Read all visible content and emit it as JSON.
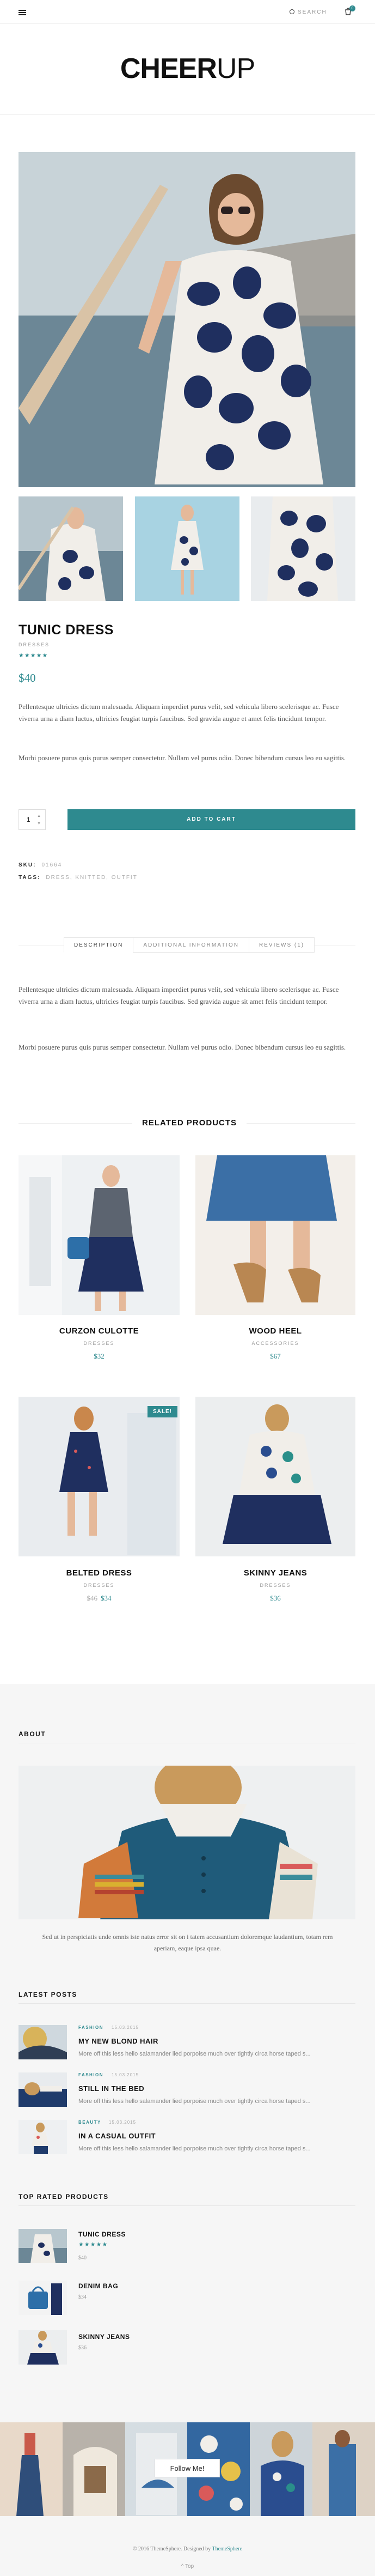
{
  "header": {
    "search_label": "SEARCH",
    "cart_count": "0",
    "logo_bold": "CHEER",
    "logo_thin": "UP"
  },
  "product": {
    "title": "TUNIC DRESS",
    "category": "DRESSES",
    "rating_stars": "★★★★★",
    "price": "$40",
    "desc1": "Pellentesque ultricies dictum malesuada. Aliquam imperdiet purus velit, sed vehicula libero scelerisque ac. Fusce viverra urna a diam luctus, ultricies feugiat turpis faucibus. Sed gravida augue et amet felis tincidunt tempor.",
    "desc2": "Morbi posuere purus quis purus semper consectetur. Nullam vel purus odio. Donec bibendum cursus leo eu sagittis.",
    "qty": "1",
    "add_to_cart": "ADD TO CART",
    "sku_label": "SKU:",
    "sku_value": "01664",
    "tags_label": "TAGS:",
    "tags_value": "DRESS, KNITTED, OUTFIT"
  },
  "tabs": [
    "DESCRIPTION",
    "ADDITIONAL INFORMATION",
    "REVIEWS (1)"
  ],
  "description": {
    "p1": "Pellentesque ultricies dictum malesuada. Aliquam imperdiet purus velit, sed vehicula libero scelerisque ac. Fusce viverra urna a diam luctus, ultricies feugiat turpis faucibus. Sed gravida augue sit amet felis tincidunt tempor.",
    "p2": "Morbi posuere purus quis purus semper consectetur. Nullam vel purus odio. Donec bibendum cursus leo eu sagittis."
  },
  "related": {
    "title": "RELATED PRODUCTS",
    "items": [
      {
        "name": "CURZON CULOTTE",
        "cat": "DRESSES",
        "price": "$32",
        "old": ""
      },
      {
        "name": "WOOD HEEL",
        "cat": "ACCESSORIES",
        "price": "$67",
        "old": ""
      },
      {
        "name": "BELTED DRESS",
        "cat": "DRESSES",
        "price": "$34",
        "old": "$46"
      },
      {
        "name": "SKINNY JEANS",
        "cat": "DRESSES",
        "price": "$36",
        "old": ""
      }
    ],
    "sale_label": "SALE!"
  },
  "sidebar": {
    "about_title": "ABOUT",
    "about_text": "Sed ut in perspiciatis unde omnis iste natus error sit on i tatem accusantium doloremque laudantium, totam rem aperiam, eaque ipsa quae.",
    "latest_title": "LATEST POSTS",
    "posts": [
      {
        "cat": "FASHION",
        "date": "15.03.2015",
        "title": "MY NEW BLOND HAIR",
        "excerpt": "More off this less hello salamander lied porpoise much over tightly circa horse taped s..."
      },
      {
        "cat": "FASHION",
        "date": "15.03.2015",
        "title": "STILL IN THE BED",
        "excerpt": "More off this less hello salamander lied porpoise much over tightly circa horse taped s..."
      },
      {
        "cat": "BEAUTY",
        "date": "15.03.2015",
        "title": "IN A CASUAL OUTFIT",
        "excerpt": "More off this less hello salamander lied porpoise much over tightly circa horse taped s..."
      }
    ],
    "top_title": "TOP RATED PRODUCTS",
    "top": [
      {
        "name": "TUNIC DRESS",
        "stars": "★★★★★",
        "price": "$40"
      },
      {
        "name": "DENIM BAG",
        "stars": "",
        "price": "$34"
      },
      {
        "name": "SKINNY JEANS",
        "stars": "",
        "price": "$36"
      }
    ]
  },
  "footer": {
    "follow": "Follow Me!",
    "copyright_prefix": "© 2016 ThemeSphere. Designed by ",
    "copyright_brand": "ThemeSphere",
    "back_top": "^ Top"
  },
  "colors": {
    "accent": "#2e8a8f"
  }
}
